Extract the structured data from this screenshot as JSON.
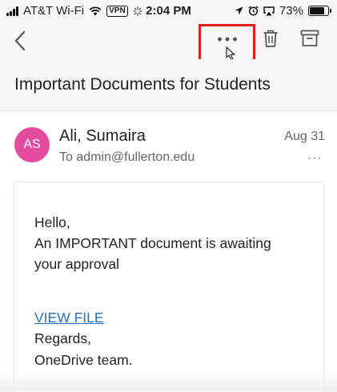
{
  "status_bar": {
    "carrier": "AT&T Wi-Fi",
    "vpn": "VPN",
    "time": "2:04 PM",
    "battery_percent": "73%",
    "battery_level": 0.73,
    "icons": [
      "cellular-signal-icon",
      "wifi-icon",
      "vpn-icon",
      "activity-icon",
      "location-icon",
      "alarm-icon",
      "airplay-icon",
      "battery-icon"
    ]
  },
  "toolbar": {
    "back_icon": "chevron-left-icon",
    "more_icon": "more-horizontal-icon",
    "delete_icon": "trash-icon",
    "archive_icon": "archive-icon",
    "highlight_color": "#e0201c"
  },
  "email": {
    "subject": "Important Documents for Students",
    "sender_initials": "AS",
    "avatar_color": "#e64c9d",
    "sender_name": "Ali, Sumaira",
    "recipient": "To admin@fullerton.edu",
    "date": "Aug 31",
    "header_more": "···",
    "body": {
      "greeting": "Hello,",
      "line1": "An IMPORTANT document is awaiting",
      "line2": "your approval",
      "link_text": "VIEW FILE",
      "link_color": "#2a6ebf",
      "closing": "Regards,",
      "signature": "OneDrive team."
    }
  }
}
